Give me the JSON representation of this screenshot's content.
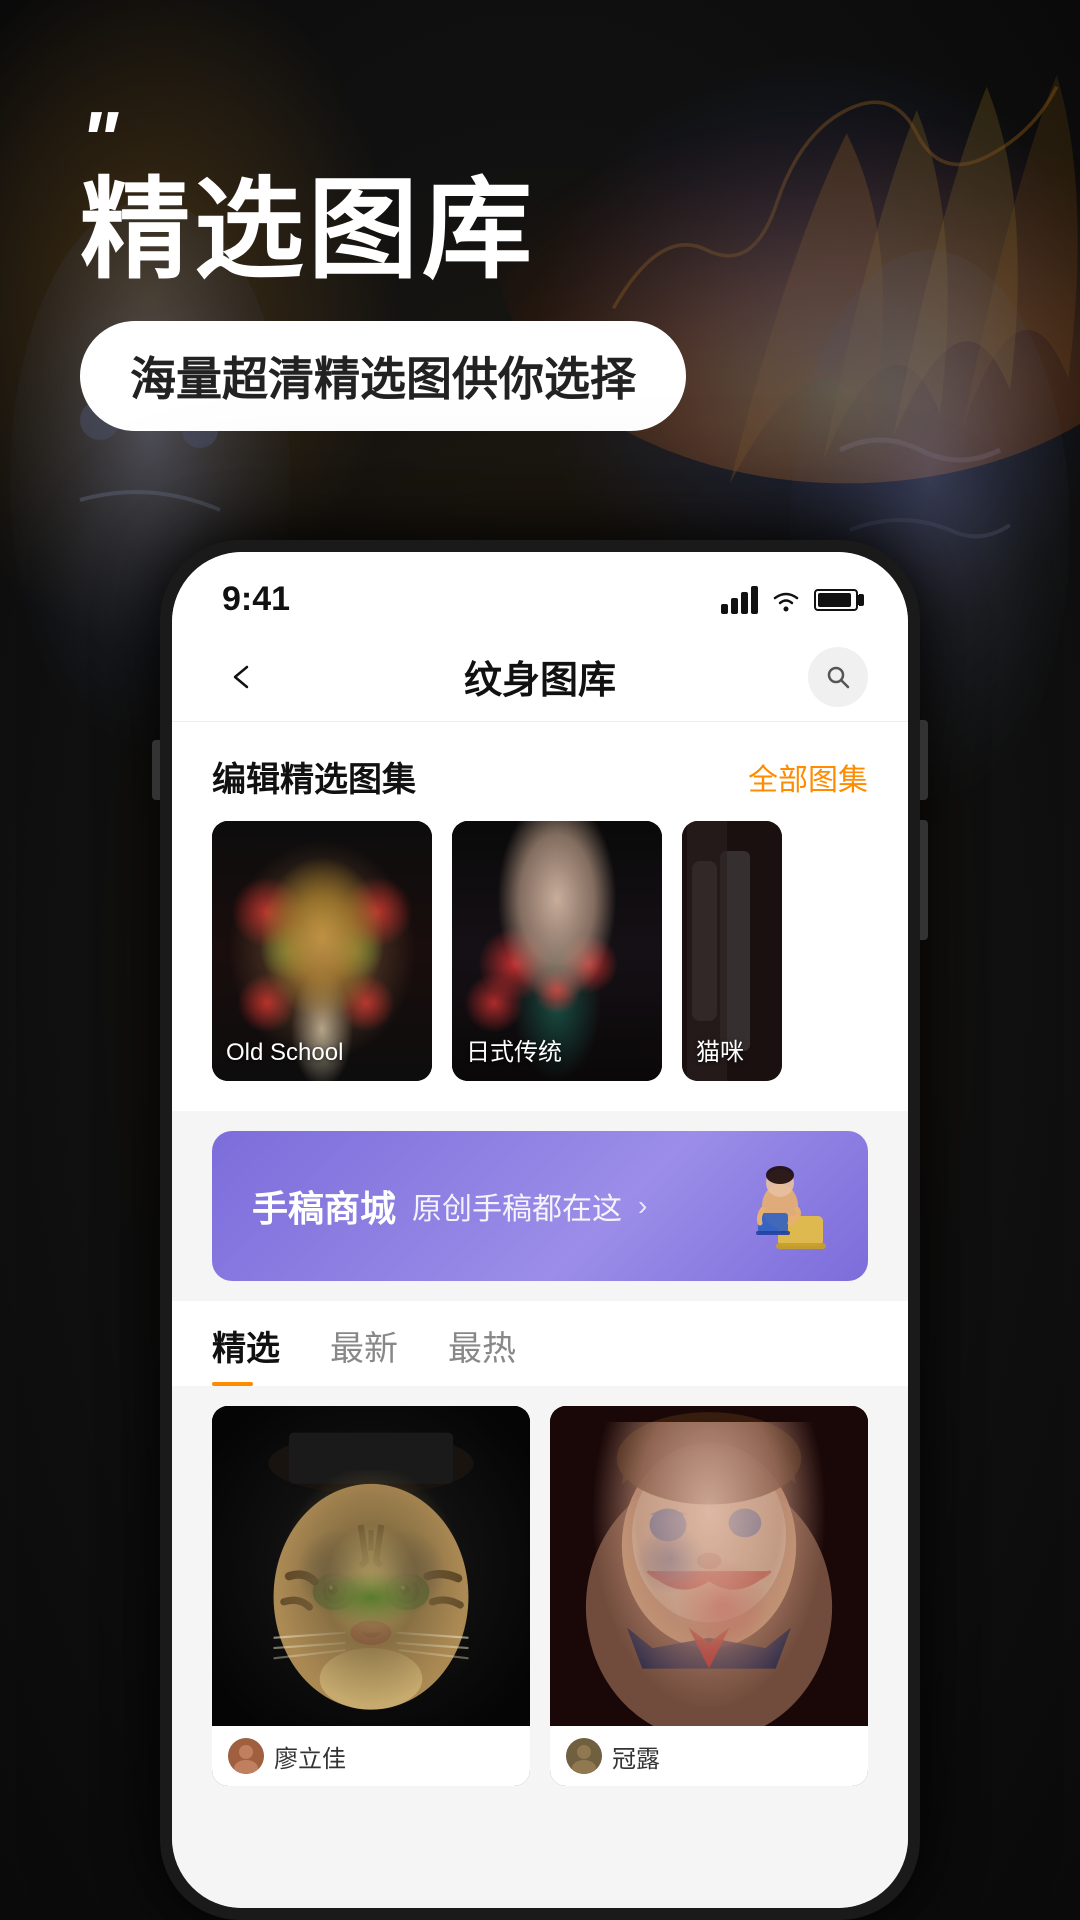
{
  "background": {
    "color": "#1a1a1a"
  },
  "header": {
    "quote_marks": "\"",
    "main_title": "精选图库",
    "subtitle": "海量超清精选图供你选择"
  },
  "status_bar": {
    "time": "9:41",
    "signal": "signal",
    "wifi": "wifi",
    "battery": "battery"
  },
  "nav": {
    "back_label": "‹",
    "title": "纹身图库",
    "search_label": "search"
  },
  "featured_section": {
    "title": "编辑精选图集",
    "link": "全部图集",
    "cards": [
      {
        "label": "Old School",
        "type": "hourglass"
      },
      {
        "label": "日式传统",
        "type": "geisha"
      },
      {
        "label": "猫咪",
        "type": "cat"
      }
    ]
  },
  "banner": {
    "title": "手稿商城",
    "subtitle": "原创手稿都在这",
    "arrow": "›"
  },
  "tabs": [
    {
      "label": "精选",
      "active": true
    },
    {
      "label": "最新",
      "active": false
    },
    {
      "label": "最热",
      "active": false
    }
  ],
  "grid": {
    "items": [
      {
        "artist_name": "廖立佳",
        "type": "tiger"
      },
      {
        "artist_name": "冠露",
        "type": "joker"
      }
    ]
  }
}
